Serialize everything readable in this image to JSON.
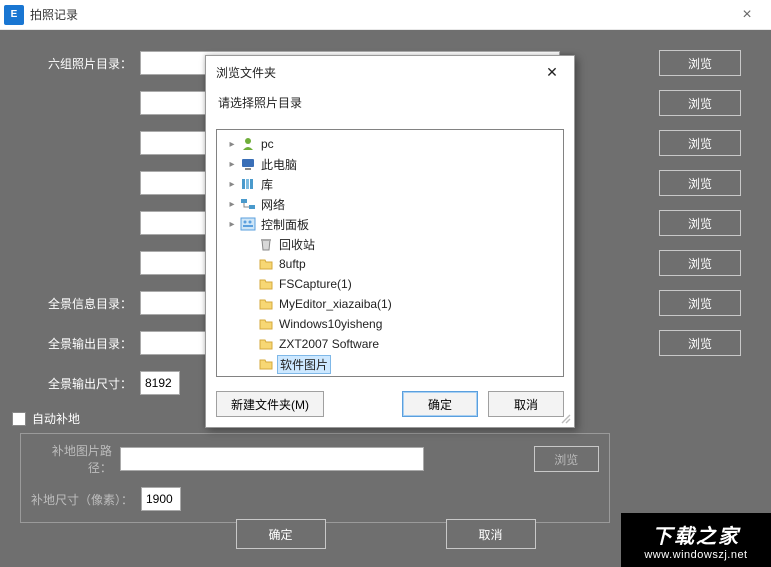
{
  "window": {
    "title": "拍照记录",
    "close_glyph": "×"
  },
  "labels": {
    "six_group_dir": "六组照片目录：",
    "pano_info_dir": "全景信息目录：",
    "pano_out_dir": "全景输出目录：",
    "pano_out_size": "全景输出尺寸：",
    "auto_ground": "自动补地",
    "ground_img_path": "补地图片路径：",
    "ground_size": "补地尺寸（像素）：",
    "browse": "浏览",
    "ok": "确定",
    "cancel": "取消"
  },
  "values": {
    "out_w": "8192",
    "ground_size": "1900"
  },
  "dialog": {
    "title": "浏览文件夹",
    "close_glyph": "✕",
    "instruction": "请选择照片目录",
    "new_folder": "新建文件夹(M)",
    "ok": "确定",
    "cancel": "取消",
    "tree": [
      {
        "indent": 0,
        "expander": "▸",
        "icon": "user",
        "label": "pc"
      },
      {
        "indent": 0,
        "expander": "▸",
        "icon": "pc",
        "label": "此电脑"
      },
      {
        "indent": 0,
        "expander": "▸",
        "icon": "lib",
        "label": "库"
      },
      {
        "indent": 0,
        "expander": "▸",
        "icon": "net",
        "label": "网络"
      },
      {
        "indent": 0,
        "expander": "▸",
        "icon": "cp",
        "label": "控制面板"
      },
      {
        "indent": 1,
        "expander": "",
        "icon": "bin",
        "label": "回收站"
      },
      {
        "indent": 1,
        "expander": "",
        "icon": "folder",
        "label": "8uftp"
      },
      {
        "indent": 1,
        "expander": "",
        "icon": "folder",
        "label": "FSCapture(1)"
      },
      {
        "indent": 1,
        "expander": "",
        "icon": "folder",
        "label": "MyEditor_xiazaiba(1)"
      },
      {
        "indent": 1,
        "expander": "",
        "icon": "folder",
        "label": "Windows10yisheng"
      },
      {
        "indent": 1,
        "expander": "",
        "icon": "folder",
        "label": "ZXT2007 Software"
      },
      {
        "indent": 1,
        "expander": "",
        "icon": "folder",
        "label": "软件图片",
        "selected": true
      }
    ]
  },
  "watermark": {
    "line1": "下载之家",
    "line2": "www.windowszj.net"
  }
}
